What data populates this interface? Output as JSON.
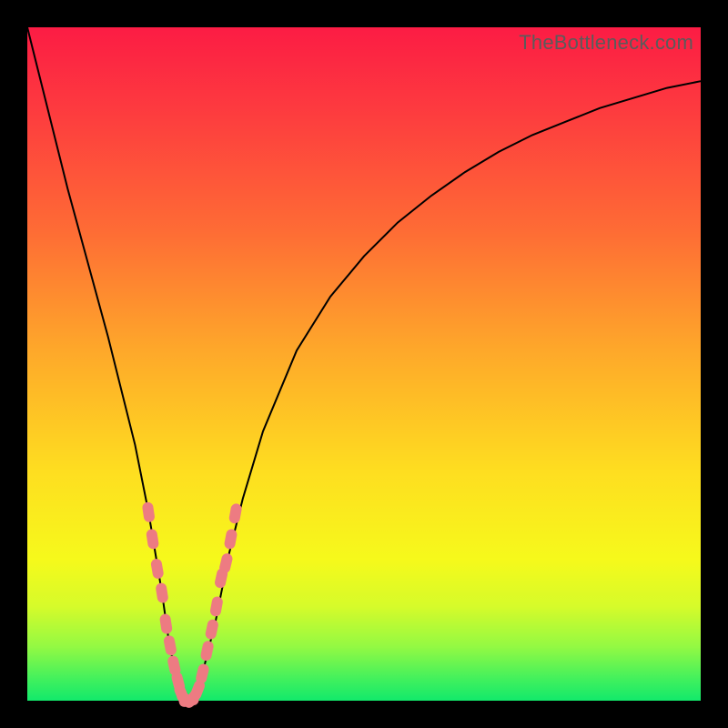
{
  "watermark": "TheBottleneck.com",
  "colors": {
    "frame": "#000000",
    "gradient_top": "#fc1c44",
    "gradient_bottom": "#12e96b",
    "curve": "#000000",
    "marker": "#ed7b82"
  },
  "chart_data": {
    "type": "line",
    "title": "",
    "xlabel": "",
    "ylabel": "",
    "xlim": [
      0,
      100
    ],
    "ylim": [
      0,
      100
    ],
    "x": [
      0,
      3,
      6,
      9,
      12,
      14,
      16,
      18,
      20,
      21,
      22,
      23,
      24,
      25,
      26,
      28,
      30,
      32,
      35,
      40,
      45,
      50,
      55,
      60,
      65,
      70,
      75,
      80,
      85,
      90,
      95,
      100
    ],
    "values": [
      100,
      88,
      76,
      65,
      54,
      46,
      38,
      28,
      16,
      9,
      4,
      1,
      0,
      1,
      4,
      12,
      22,
      30,
      40,
      52,
      60,
      66,
      71,
      75,
      78.5,
      81.5,
      84,
      86,
      88,
      89.5,
      91,
      92
    ],
    "markers": {
      "x": [
        18.0,
        18.6,
        19.3,
        20.0,
        20.6,
        21.2,
        21.8,
        22.4,
        22.9,
        23.5,
        24.0,
        24.6,
        25.3,
        26.0,
        26.7,
        27.4,
        28.1,
        28.8,
        29.5,
        30.2,
        30.9
      ],
      "values": [
        28.0,
        24.0,
        19.6,
        16.0,
        11.4,
        8.2,
        5.2,
        2.8,
        1.0,
        0.2,
        0.0,
        0.4,
        1.6,
        4.0,
        7.4,
        10.6,
        14.0,
        18.2,
        20.4,
        24.0,
        27.8
      ]
    }
  }
}
